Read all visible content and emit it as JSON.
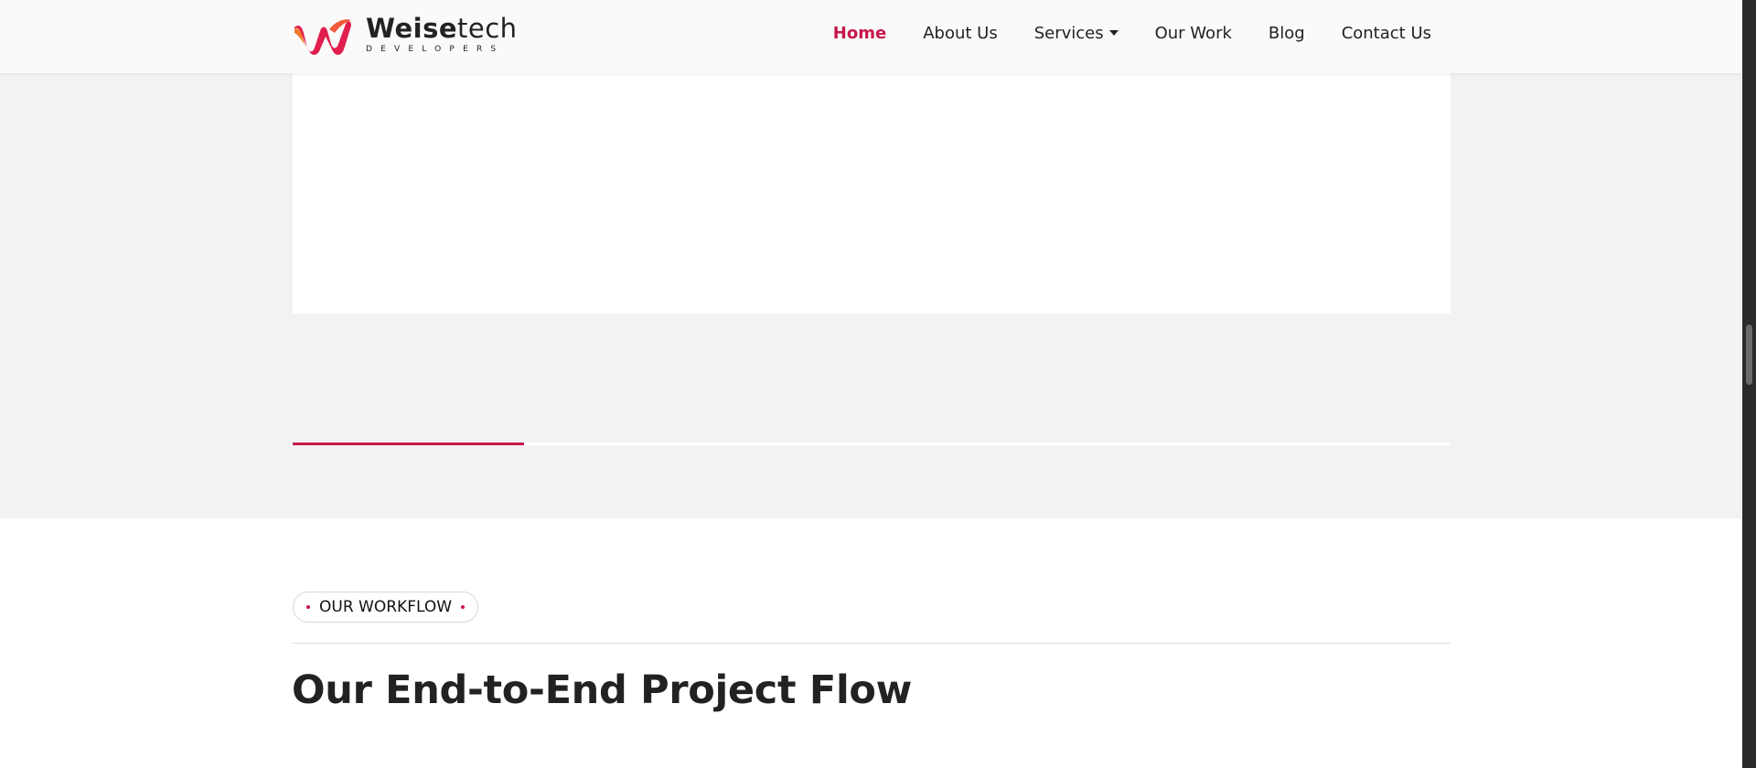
{
  "brand": {
    "name_bold": "Weise",
    "name_light": "tech",
    "tagline": "DEVELOPERS",
    "logo_icon": "weisetech-logo-mark",
    "accent_color": "#c8174a"
  },
  "nav": {
    "items": [
      {
        "label": "Home",
        "active": true
      },
      {
        "label": "About Us",
        "active": false
      },
      {
        "label": "Services",
        "active": false,
        "dropdown": true
      },
      {
        "label": "Our Work",
        "active": false
      },
      {
        "label": "Blog",
        "active": false
      },
      {
        "label": "Contact Us",
        "active": false
      }
    ]
  },
  "carousel": {
    "progress": 0.2
  },
  "workflow": {
    "tag": "OUR WORKFLOW",
    "title": "Our End-to-End Project Flow",
    "intro": ""
  }
}
